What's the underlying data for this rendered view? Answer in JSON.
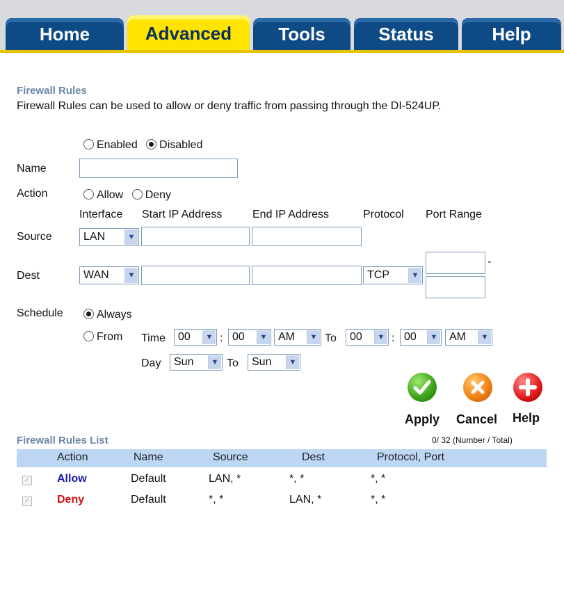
{
  "tabs": [
    {
      "label": "Home"
    },
    {
      "label": "Advanced"
    },
    {
      "label": "Tools"
    },
    {
      "label": "Status"
    },
    {
      "label": "Help"
    }
  ],
  "firewall": {
    "title": "Firewall Rules",
    "description": "Firewall Rules can be used to allow or deny traffic from passing through the DI-524UP.",
    "enabled_label": "Enabled",
    "disabled_label": "Disabled",
    "name_label": "Name",
    "name_value": "",
    "action_label": "Action",
    "allow_label": "Allow",
    "deny_label": "Deny",
    "col_interface": "Interface",
    "col_start_ip": "Start IP Address",
    "col_end_ip": "End IP Address",
    "col_protocol": "Protocol",
    "col_port_range": "Port Range",
    "source_label": "Source",
    "source_interface": "LAN",
    "dest_label": "Dest",
    "dest_interface": "WAN",
    "dest_protocol": "TCP",
    "port_dash": "-",
    "schedule_label": "Schedule",
    "always_label": "Always",
    "from_label": "From",
    "time_label": "Time",
    "to_label": "To",
    "day_label": "Day",
    "colon": ":",
    "time_from_hour": "00",
    "time_from_min": "00",
    "time_from_ampm": "AM",
    "time_to_hour": "00",
    "time_to_min": "00",
    "time_to_ampm": "AM",
    "day_from": "Sun",
    "day_to": "Sun"
  },
  "buttons": {
    "apply": "Apply",
    "cancel": "Cancel",
    "help": "Help"
  },
  "rules_list": {
    "title": "Firewall Rules List",
    "count": "0/ 32 (Number / Total)",
    "headers": [
      "Action",
      "Name",
      "Source",
      "Dest",
      "Protocol, Port"
    ],
    "rows": [
      {
        "action": "Allow",
        "action_color": "#1a1aaa",
        "name": "Default",
        "source": "LAN, *",
        "dest": "*, *",
        "protocol_port": "*, *"
      },
      {
        "action": "Deny",
        "action_color": "#d01010",
        "name": "Default",
        "source": "*, *",
        "dest": "LAN, *",
        "protocol_port": "*, *"
      }
    ]
  }
}
